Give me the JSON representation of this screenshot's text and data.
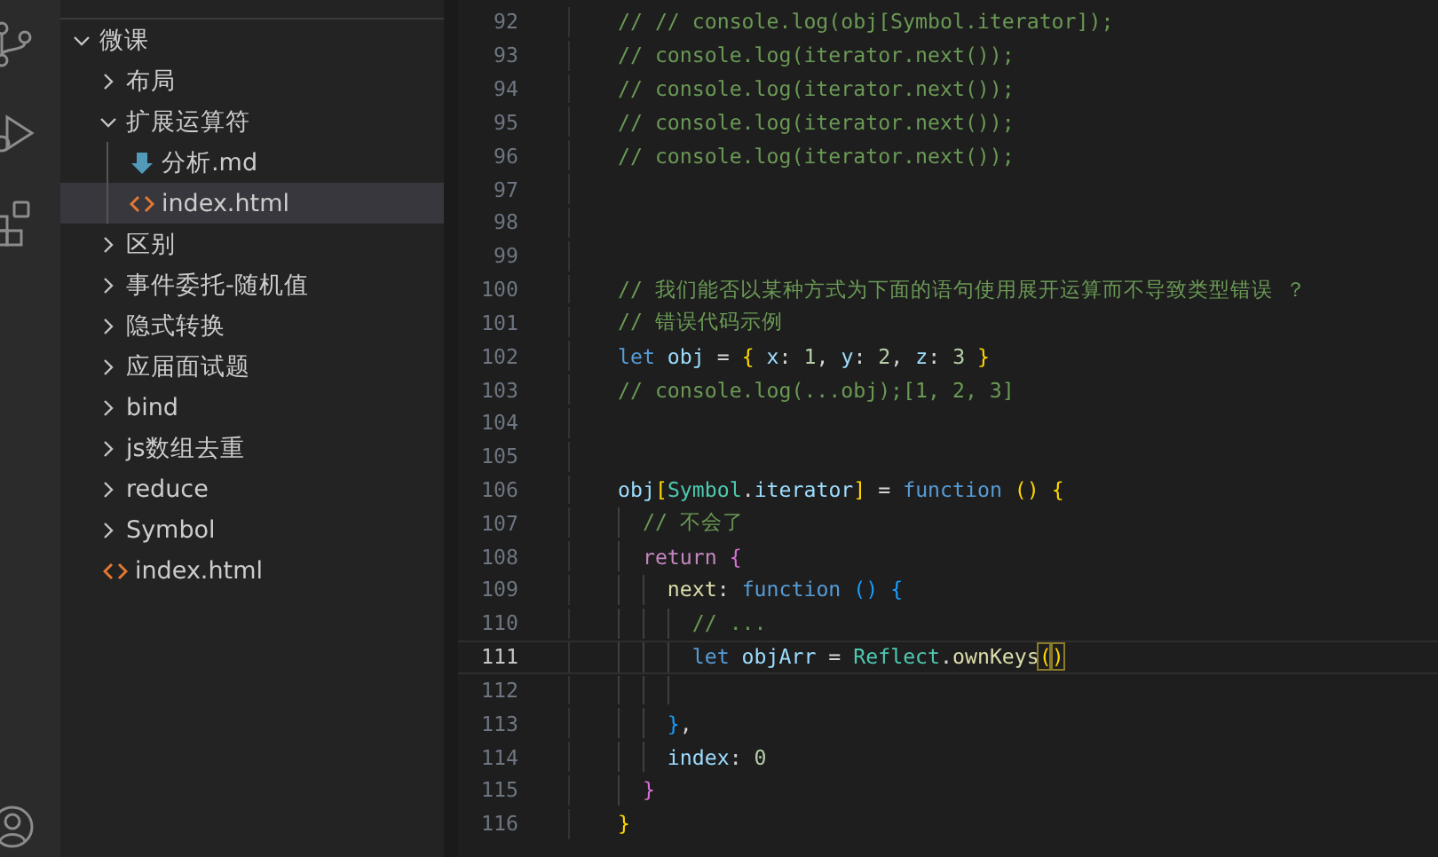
{
  "activity_bar": {
    "items": [
      {
        "kind": "source-control",
        "selected": false
      },
      {
        "kind": "run",
        "selected": false
      },
      {
        "kind": "extensions",
        "selected": false
      },
      {
        "kind": "account",
        "selected": false
      }
    ]
  },
  "sidebar": {
    "tree": [
      {
        "label": "微课",
        "kind": "folder",
        "expanded": true,
        "selected": false,
        "children": [
          {
            "label": "布局",
            "kind": "folder",
            "expanded": false,
            "selected": false
          },
          {
            "label": "扩展运算符",
            "kind": "folder",
            "expanded": true,
            "selected": false,
            "children": [
              {
                "label": "分析.md",
                "kind": "markdown",
                "selected": false
              },
              {
                "label": "index.html",
                "kind": "html",
                "selected": true
              }
            ]
          },
          {
            "label": "区别",
            "kind": "folder",
            "expanded": false,
            "selected": false
          },
          {
            "label": "事件委托-随机值",
            "kind": "folder",
            "expanded": false,
            "selected": false
          },
          {
            "label": "隐式转换",
            "kind": "folder",
            "expanded": false,
            "selected": false
          },
          {
            "label": "应届面试题",
            "kind": "folder",
            "expanded": false,
            "selected": false
          },
          {
            "label": "bind",
            "kind": "folder",
            "expanded": false,
            "selected": false
          },
          {
            "label": "js数组去重",
            "kind": "folder",
            "expanded": false,
            "selected": false
          },
          {
            "label": "reduce",
            "kind": "folder",
            "expanded": false,
            "selected": false
          },
          {
            "label": "Symbol",
            "kind": "folder",
            "expanded": false,
            "selected": false
          },
          {
            "label": "index.html",
            "kind": "html",
            "selected": false
          }
        ]
      }
    ]
  },
  "editor": {
    "lines": [
      {
        "number": "92",
        "current": false,
        "tokens": [
          {
            "kind": "comment",
            "text": "// // console.log(obj[Symbol.iterator]);"
          }
        ]
      },
      {
        "number": "93",
        "current": false,
        "tokens": [
          {
            "kind": "comment",
            "text": "// console.log(iterator.next());"
          }
        ]
      },
      {
        "number": "94",
        "current": false,
        "tokens": [
          {
            "kind": "comment",
            "text": "// console.log(iterator.next());"
          }
        ]
      },
      {
        "number": "95",
        "current": false,
        "tokens": [
          {
            "kind": "comment",
            "text": "// console.log(iterator.next());"
          }
        ]
      },
      {
        "number": "96",
        "current": false,
        "tokens": [
          {
            "kind": "comment",
            "text": "// console.log(iterator.next());"
          }
        ]
      },
      {
        "number": "97",
        "current": false
      },
      {
        "number": "98",
        "current": false
      },
      {
        "number": "99",
        "current": false
      },
      {
        "number": "100",
        "current": false,
        "tokens": [
          {
            "kind": "comment",
            "text": "// 我们能否以某种方式为下面的语句使用展开运算而不导致类型错误 ？"
          }
        ]
      },
      {
        "number": "101",
        "current": false,
        "tokens": [
          {
            "kind": "comment",
            "text": "// 错误代码示例"
          }
        ]
      },
      {
        "number": "102",
        "current": false,
        "tokens": [
          {
            "kind": "keyword",
            "text": "let"
          },
          {
            "kind": "variable",
            "text": " obj"
          },
          {
            "kind": "plain",
            "text": " = "
          },
          {
            "kind": "bracket-gold",
            "text": "{"
          },
          {
            "kind": "variable",
            "text": " x"
          },
          {
            "kind": "plain",
            "text": ": "
          },
          {
            "kind": "number",
            "text": "1"
          },
          {
            "kind": "plain",
            "text": ", "
          },
          {
            "kind": "variable",
            "text": "y"
          },
          {
            "kind": "plain",
            "text": ": "
          },
          {
            "kind": "number",
            "text": "2"
          },
          {
            "kind": "plain",
            "text": ", "
          },
          {
            "kind": "variable",
            "text": "z"
          },
          {
            "kind": "plain",
            "text": ": "
          },
          {
            "kind": "number",
            "text": "3"
          },
          {
            "kind": "bracket-gold",
            "text": " }"
          }
        ]
      },
      {
        "number": "103",
        "current": false,
        "tokens": [
          {
            "kind": "comment",
            "text": "// console.log(...obj);[1, 2, 3]"
          }
        ]
      },
      {
        "number": "104",
        "current": false
      },
      {
        "number": "105",
        "current": false
      },
      {
        "number": "106",
        "current": false,
        "tokens": [
          {
            "kind": "variable",
            "text": "obj"
          },
          {
            "kind": "bracket-gold",
            "text": "["
          },
          {
            "kind": "type",
            "text": "Symbol"
          },
          {
            "kind": "plain",
            "text": "."
          },
          {
            "kind": "variable",
            "text": "iterator"
          },
          {
            "kind": "bracket-gold",
            "text": "]"
          },
          {
            "kind": "plain",
            "text": " = "
          },
          {
            "kind": "keyword",
            "text": "function"
          },
          {
            "kind": "bracket-gold",
            "text": " () {"
          }
        ]
      },
      {
        "number": "107",
        "current": false,
        "tokens": [
          {
            "kind": "comment",
            "text": "  // 不会了"
          }
        ]
      },
      {
        "number": "108",
        "current": false,
        "tokens": [
          {
            "kind": "control",
            "text": "  return"
          },
          {
            "kind": "bracket-purple",
            "text": " {"
          }
        ]
      },
      {
        "number": "109",
        "current": false,
        "tokens": [
          {
            "kind": "function",
            "text": "    next"
          },
          {
            "kind": "plain",
            "text": ": "
          },
          {
            "kind": "keyword",
            "text": "function"
          },
          {
            "kind": "bracket-blue",
            "text": " () {"
          }
        ]
      },
      {
        "number": "110",
        "current": false,
        "tokens": [
          {
            "kind": "comment",
            "text": "      // ..."
          }
        ]
      },
      {
        "number": "111",
        "current": true,
        "tokens": [
          {
            "kind": "keyword",
            "text": "      let"
          },
          {
            "kind": "variable",
            "text": " objArr"
          },
          {
            "kind": "plain",
            "text": " = "
          },
          {
            "kind": "type",
            "text": "Reflect"
          },
          {
            "kind": "plain",
            "text": "."
          },
          {
            "kind": "function",
            "text": "ownKeys"
          },
          {
            "kind": "bracket-match",
            "text": "("
          },
          {
            "kind": "bracket-match",
            "text": ")"
          }
        ]
      },
      {
        "number": "112",
        "current": false
      },
      {
        "number": "113",
        "current": false,
        "tokens": [
          {
            "kind": "bracket-blue",
            "text": "    }"
          },
          {
            "kind": "plain",
            "text": ","
          }
        ]
      },
      {
        "number": "114",
        "current": false,
        "tokens": [
          {
            "kind": "variable",
            "text": "    index"
          },
          {
            "kind": "plain",
            "text": ": "
          },
          {
            "kind": "number",
            "text": "0"
          }
        ]
      },
      {
        "number": "115",
        "current": false,
        "tokens": [
          {
            "kind": "bracket-purple",
            "text": "  }"
          }
        ]
      },
      {
        "number": "116",
        "current": false,
        "tokens": [
          {
            "kind": "bracket-gold",
            "text": "}"
          }
        ]
      }
    ]
  }
}
